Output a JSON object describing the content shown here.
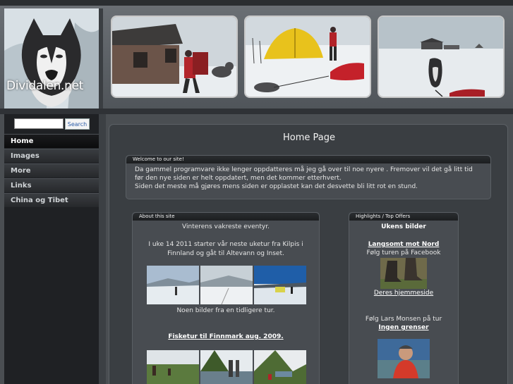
{
  "site": {
    "logo_text": "Dividalen.net"
  },
  "search": {
    "placeholder": "",
    "button_label": "Search"
  },
  "nav": {
    "items": [
      {
        "label": "Home",
        "active": true
      },
      {
        "label": "Images",
        "active": false
      },
      {
        "label": "More",
        "active": false
      },
      {
        "label": "Links",
        "active": false
      },
      {
        "label": "China og Tibet",
        "active": false
      }
    ]
  },
  "main": {
    "title": "Home Page",
    "welcome": {
      "heading": "Welcome to our site!",
      "line1": "Da gammel programvare ikke lenger oppdatteres må jeg gå over til noe nyere . Fremover vil det gå litt tid før den nye siden er helt oppdatert, men det kommer etterhvert.",
      "line2": "Siden det meste må gjøres mens siden er opplastet kan det desvette bli litt rot en stund."
    },
    "about": {
      "heading": "About this site",
      "line1": "Vinterens vakreste eventyr.",
      "line2": "I uke 14 2011 starter vår neste uketur fra Kilpis i Finnland og gåt til Altevann og Inset.",
      "caption1": "Noen bilder fra en tidligere tur.",
      "link1": "Fisketur til Finnmark aug. 2009."
    },
    "highlights": {
      "heading": "Highlights / Top Offers",
      "title": "Ukens bilder",
      "link1": "Langsomt mot Nord",
      "text1": "Følg turen på Facebook",
      "link2": "Deres hjemmeside",
      "text2": "Følg Lars Monsen på tur",
      "link3": "Ingen grenser"
    }
  }
}
